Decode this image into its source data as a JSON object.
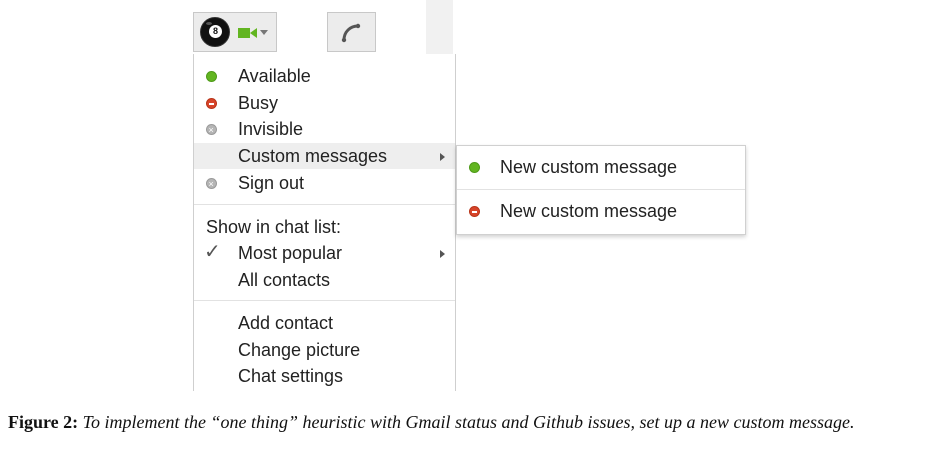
{
  "toolbar": {
    "avatar_icon": "billiard-8-ball-avatar",
    "avatar_text": "8",
    "video_icon": "video-camera-icon",
    "phone_icon": "phone-icon"
  },
  "colors": {
    "available": "#62b521",
    "busy": "#d7442a",
    "invisible": "#b5b5b5",
    "highlight": "#eeeeee"
  },
  "status_menu": {
    "items": [
      {
        "label": "Available",
        "icon": "green-dot-icon"
      },
      {
        "label": "Busy",
        "icon": "red-dot-icon"
      },
      {
        "label": "Invisible",
        "icon": "gray-dot-icon"
      },
      {
        "label": "Custom messages",
        "icon": "submenu-arrow-icon"
      },
      {
        "label": "Sign out",
        "icon": "gray-dot-icon"
      }
    ],
    "chat_list_header": "Show in chat list:",
    "chat_list_items": [
      {
        "label": "Most popular",
        "checked": true
      },
      {
        "label": "All contacts",
        "checked": false
      }
    ],
    "actions": [
      {
        "label": "Add contact"
      },
      {
        "label": "Change picture"
      },
      {
        "label": "Chat settings"
      }
    ]
  },
  "submenu": {
    "items": [
      {
        "label": "New custom message",
        "icon": "green-dot-icon"
      },
      {
        "label": "New custom message",
        "icon": "red-dot-icon"
      }
    ]
  },
  "caption": {
    "figure": "Figure 2:",
    "text": "To implement the “one thing” heuristic with Gmail status and Github issues, set up a new custom message."
  }
}
